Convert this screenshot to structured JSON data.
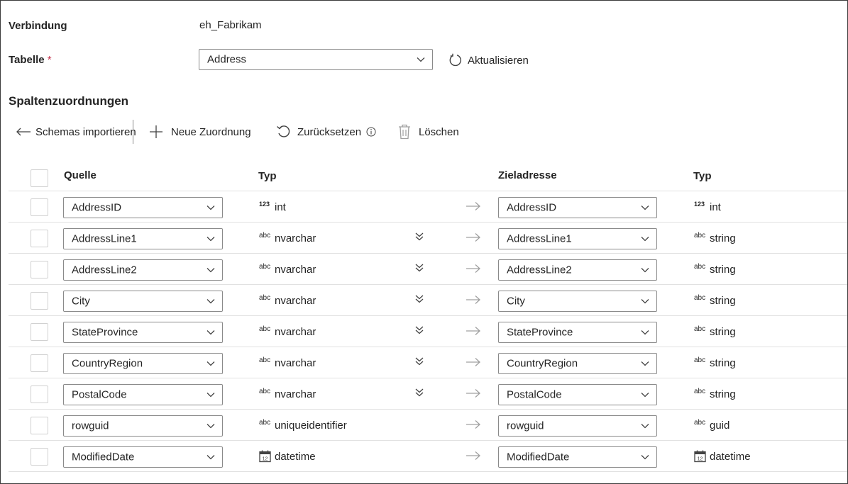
{
  "connection": {
    "label": "Verbindung",
    "value": "eh_Fabrikam"
  },
  "table": {
    "label": "Tabelle",
    "required_mark": "*",
    "selected": "Address",
    "refresh_label": "Aktualisieren"
  },
  "mappings": {
    "title": "Spaltenzuordnungen",
    "toolbar": {
      "import_label": "Schemas importieren",
      "new_label": "Neue Zuordnung",
      "reset_label": "Zurücksetzen",
      "delete_label": "Löschen"
    },
    "headers": {
      "source": "Quelle",
      "source_type": "Typ",
      "destination": "Zieladresse",
      "dest_type": "Typ"
    },
    "rows": [
      {
        "source": "AddressID",
        "source_type_glyph": "123",
        "source_type": "int",
        "expandable": false,
        "destination": "AddressID",
        "dest_type_glyph": "123",
        "dest_type": "int"
      },
      {
        "source": "AddressLine1",
        "source_type_glyph": "abc",
        "source_type": "nvarchar",
        "expandable": true,
        "destination": "AddressLine1",
        "dest_type_glyph": "abc",
        "dest_type": "string"
      },
      {
        "source": "AddressLine2",
        "source_type_glyph": "abc",
        "source_type": "nvarchar",
        "expandable": true,
        "destination": "AddressLine2",
        "dest_type_glyph": "abc",
        "dest_type": "string"
      },
      {
        "source": "City",
        "source_type_glyph": "abc",
        "source_type": "nvarchar",
        "expandable": true,
        "destination": "City",
        "dest_type_glyph": "abc",
        "dest_type": "string"
      },
      {
        "source": "StateProvince",
        "source_type_glyph": "abc",
        "source_type": "nvarchar",
        "expandable": true,
        "destination": "StateProvince",
        "dest_type_glyph": "abc",
        "dest_type": "string"
      },
      {
        "source": "CountryRegion",
        "source_type_glyph": "abc",
        "source_type": "nvarchar",
        "expandable": true,
        "destination": "CountryRegion",
        "dest_type_glyph": "abc",
        "dest_type": "string"
      },
      {
        "source": "PostalCode",
        "source_type_glyph": "abc",
        "source_type": "nvarchar",
        "expandable": true,
        "destination": "PostalCode",
        "dest_type_glyph": "abc",
        "dest_type": "string"
      },
      {
        "source": "rowguid",
        "source_type_glyph": "abc",
        "source_type": "uniqueidentifier",
        "expandable": false,
        "destination": "rowguid",
        "dest_type_glyph": "abc",
        "dest_type": "guid"
      },
      {
        "source": "ModifiedDate",
        "source_type_glyph": "calendar",
        "source_type": "datetime",
        "expandable": false,
        "destination": "ModifiedDate",
        "dest_type_glyph": "calendar",
        "dest_type": "datetime"
      }
    ]
  },
  "colors": {
    "text": "#242424",
    "border": "#8a8a8a",
    "required": "#c4314b",
    "muted": "#a0a0a0"
  }
}
